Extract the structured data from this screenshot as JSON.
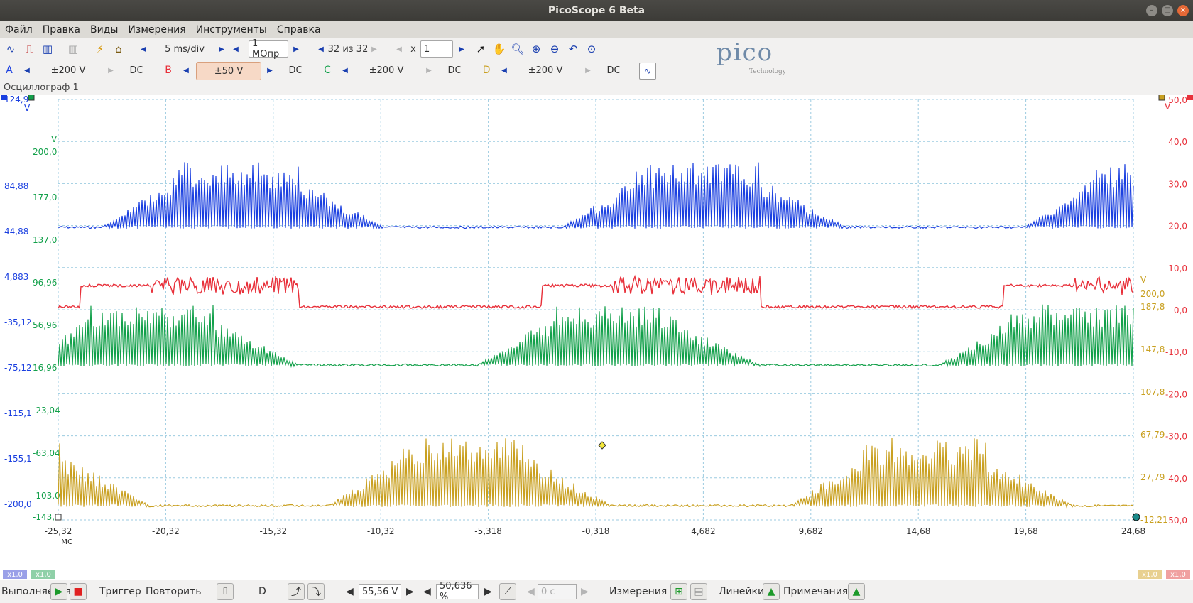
{
  "window": {
    "title": "PicoScope 6 Beta"
  },
  "menu": [
    "Файл",
    "Правка",
    "Виды",
    "Измерения",
    "Инструменты",
    "Справка"
  ],
  "toolbar": {
    "timebase": "5 ms/div",
    "samples": "1 МОпр",
    "buffer": "32 из 32",
    "zoom_label": "x",
    "zoom_value": "1"
  },
  "channels": [
    {
      "name": "A",
      "range": "±200 V",
      "coupling": "DC",
      "color": "#1a3fe0",
      "selected": false
    },
    {
      "name": "B",
      "range": "±50 V",
      "coupling": "DC",
      "color": "#e8303a",
      "selected": true
    },
    {
      "name": "C",
      "range": "±200 V",
      "coupling": "DC",
      "color": "#12a04a",
      "selected": false
    },
    {
      "name": "D",
      "range": "±200 V",
      "coupling": "DC",
      "color": "#c9a020",
      "selected": false
    }
  ],
  "logo": {
    "text": "pico",
    "sub": "Technology"
  },
  "tab": {
    "label": "Осциллограф 1"
  },
  "axes": {
    "blue_ticks": [
      "124,9",
      "84,88",
      "44,88",
      "4,883",
      "-35,12",
      "-75,12",
      "-115,1",
      "-155,1",
      "-200,0"
    ],
    "blue_unit": "V",
    "green_ticks": [
      "200,0",
      "177,0",
      "137,0",
      "96,96",
      "56,96",
      "16,96",
      "-23,04",
      "-63,04",
      "-103,0",
      "-143,0"
    ],
    "green_unit": "V",
    "red_ticks": [
      "50,0",
      "40,0",
      "30,0",
      "20,0",
      "10,0",
      "0,0",
      "-10,0",
      "-20,0",
      "-30,0",
      "-40,0",
      "-50,0"
    ],
    "red_unit": "V",
    "gold_ticks": [
      "200,0",
      "187,8",
      "147,8",
      "107,8",
      "67,79",
      "27,79",
      "-12,21"
    ],
    "gold_unit": "V",
    "x_ticks": [
      "-25,32",
      "-20,32",
      "-15,32",
      "-10,32",
      "-5,318",
      "-0,318",
      "4,682",
      "9,682",
      "14,68",
      "19,68",
      "24,68"
    ],
    "x_unit": "мс",
    "scale_badges": [
      "x1,0",
      "x1,0",
      "x1,0",
      "x1,0"
    ]
  },
  "bottom": {
    "run_label": "Выполняется",
    "trigger_label": "Триггер",
    "trigger_mode": "Повторить",
    "trigger_source": "D",
    "trigger_level": "55,56 V",
    "pretrigger": "50,636 %",
    "delay": "0 с",
    "measurements": "Измерения",
    "rulers": "Линейки",
    "notes": "Примечания"
  }
}
